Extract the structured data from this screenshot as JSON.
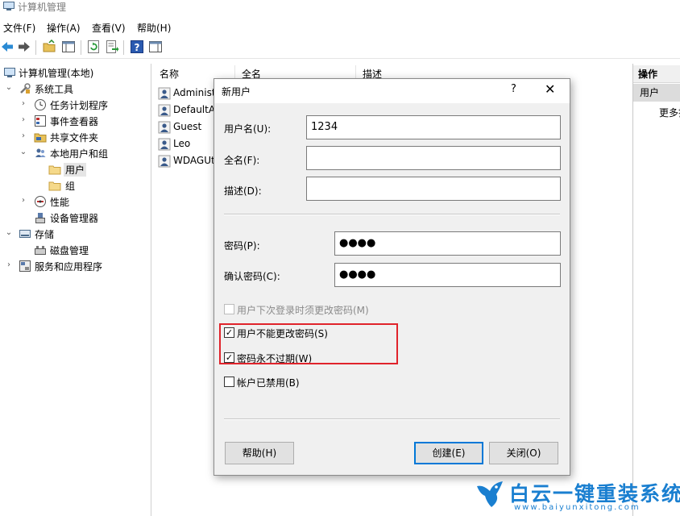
{
  "window": {
    "title": "计算机管理"
  },
  "menu": [
    "文件(F)",
    "操作(A)",
    "查看(V)",
    "帮助(H)"
  ],
  "toolbar": {
    "icons": [
      "back-arrow-icon",
      "forward-arrow-icon",
      "folder-up-icon",
      "show-hide-tree-icon",
      "refresh-icon",
      "export-list-icon",
      "help-icon",
      "show-hide-action-pane-icon"
    ]
  },
  "tree": {
    "root": "计算机管理(本地)",
    "system_tools": "系统工具",
    "task_scheduler": "任务计划程序",
    "event_viewer": "事件查看器",
    "shared_folders": "共享文件夹",
    "local_users_groups": "本地用户和组",
    "users": "用户",
    "groups": "组",
    "performance": "性能",
    "device_manager": "设备管理器",
    "storage": "存储",
    "disk_management": "磁盘管理",
    "services_apps": "服务和应用程序"
  },
  "list": {
    "columns": [
      "名称",
      "全名",
      "描述"
    ],
    "rows": [
      "Administ",
      "DefaultAc",
      "Guest",
      "Leo",
      "WDAGUti"
    ]
  },
  "actions": {
    "header": "操作",
    "section": "用户",
    "more": "更多操"
  },
  "dialog": {
    "title": "新用户",
    "help_button": "?",
    "close_button": "✕",
    "username_label": "用户名(U):",
    "username_value": "1234",
    "fullname_label": "全名(F):",
    "fullname_value": "",
    "description_label": "描述(D):",
    "description_value": "",
    "password_label": "密码(P):",
    "password_value": "●●●●",
    "confirm_label": "确认密码(C):",
    "confirm_value": "●●●●",
    "must_change": {
      "label": "用户下次登录时须更改密码(M)",
      "checked": false,
      "disabled": true
    },
    "cannot_change": {
      "label": "用户不能更改密码(S)",
      "checked": true
    },
    "never_expires": {
      "label": "密码永不过期(W)",
      "checked": true
    },
    "disabled_account": {
      "label": "帐户已禁用(B)",
      "checked": false
    },
    "help_label": "帮助(H)",
    "create_label": "创建(E)",
    "close_label": "关闭(O)"
  },
  "watermark": {
    "text": "白云一键重装系统",
    "url": "www.baiyunxitong.com"
  },
  "colors": {
    "accent": "#0078d7",
    "highlight_box": "#e0232b",
    "watermark": "#1a7fd0",
    "dialog_bg": "#f0f0f0"
  }
}
